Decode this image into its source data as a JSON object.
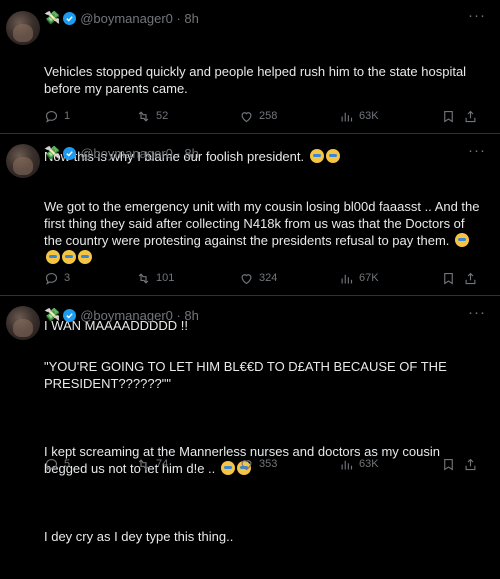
{
  "tweets": [
    {
      "handle": "@boymanager0 · 8h",
      "cash_emoji": "💸",
      "paragraphs": [
        "Vehicles stopped quickly and people helped rush him to the state hospital before my parents came.",
        "Now this is why I blame our foolish president."
      ],
      "stats": {
        "replies": "1",
        "retweets": "52",
        "likes": "258",
        "views": "63K"
      }
    },
    {
      "handle": "@boymanager0 · 8h",
      "cash_emoji": "💸",
      "paragraphs": [
        "We got to the emergency unit with my cousin losing bl00d faaasst .. And the first thing they said after collecting N418k from us was that the Doctors of the country were protesting against the presidents refusal to pay them.",
        "I WAN MAAAADDDDD !!"
      ],
      "stats": {
        "replies": "3",
        "retweets": "101",
        "likes": "324",
        "views": "67K"
      }
    },
    {
      "handle": "@boymanager0 · 8h",
      "cash_emoji": "💸",
      "paragraphs": [
        "\"YOU'RE GOING TO LET HIM BL€€D TO D£ATH BECAUSE OF THE PRESIDENT??????\"\"",
        "I kept screaming at the Mannerless nurses and doctors as my cousin begged us not to let him d!e ..",
        "I dey cry as I dey type this thing.."
      ],
      "stats": {
        "replies": "5",
        "retweets": "74",
        "likes": "353",
        "views": "63K"
      }
    }
  ],
  "more_label": "···",
  "icons": [
    "reply-icon",
    "retweet-icon",
    "like-icon",
    "views-icon",
    "bookmark-icon",
    "share-icon",
    "verified-badge-icon",
    "more-icon"
  ]
}
